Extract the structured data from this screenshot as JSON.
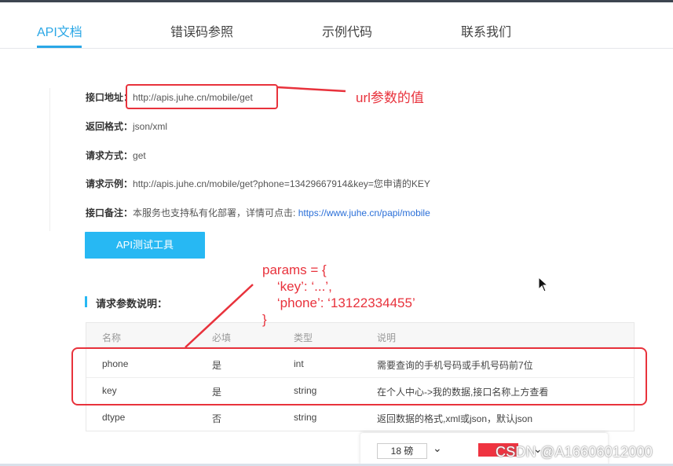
{
  "tabs": [
    {
      "label": "API文档",
      "active": true
    },
    {
      "label": "错误码参照",
      "active": false
    },
    {
      "label": "示例代码",
      "active": false
    },
    {
      "label": "联系我们",
      "active": false
    }
  ],
  "info": {
    "address_label": "接口地址：",
    "address_value": "http://apis.juhe.cn/mobile/get",
    "format_label": "返回格式：",
    "format_value": "json/xml",
    "method_label": "请求方式：",
    "method_value": "get",
    "example_label": "请求示例：",
    "example_value": "http://apis.juhe.cn/mobile/get?phone=13429667914&key=您申请的KEY",
    "note_label": "接口备注：",
    "note_value": "本服务也支持私有化部署，详情可点击: ",
    "note_link": "https://www.juhe.cn/papi/mobile"
  },
  "api_button": "API测试工具",
  "section_title": "请求参数说明：",
  "table": {
    "headers": [
      "名称",
      "必填",
      "类型",
      "说明"
    ],
    "rows": [
      [
        "phone",
        "是",
        "int",
        "需要查询的手机号码或手机号码前7位"
      ],
      [
        "key",
        "是",
        "string",
        "在个人中心->我的数据,接口名称上方查看"
      ],
      [
        "dtype",
        "否",
        "string",
        "返回数据的格式,xml或json，默认json"
      ]
    ]
  },
  "annotations": {
    "url_note": "url参数的值",
    "params_text": "params = {\n    ‘key’: ‘...’,\n    ‘phone’: ‘13122334455’\n}",
    "color": "#e8323c"
  },
  "toolbar": {
    "font_size": "18 磅",
    "text_color": "#ef3340"
  },
  "watermark": "CSDN @A16606012000"
}
